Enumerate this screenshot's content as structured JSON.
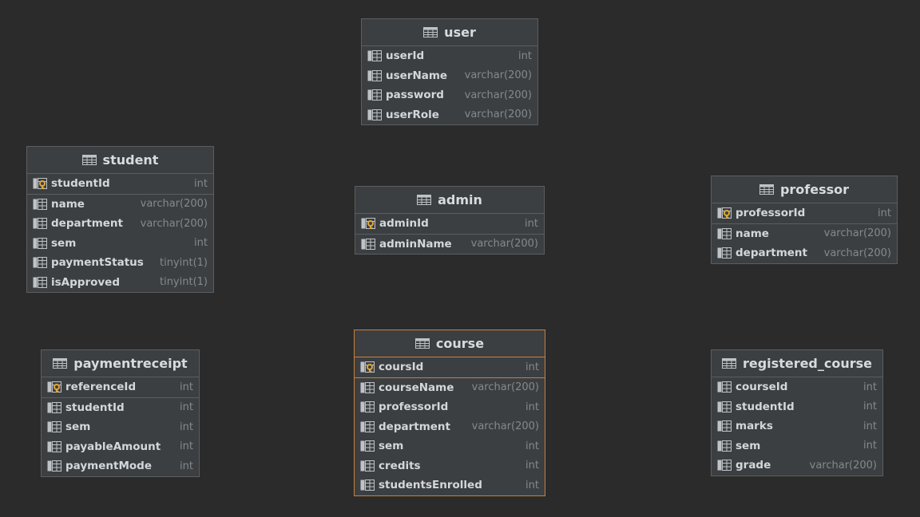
{
  "canvas": {
    "background": "#2b2b2b",
    "border_color": "#5b5e60",
    "selected_border_color": "#c97f3b",
    "key_icon_color": "#e0a83a"
  },
  "tables": {
    "user": {
      "name": "user",
      "columns": [
        {
          "name": "userId",
          "type": "int",
          "icon": "column-icon"
        },
        {
          "name": "userName",
          "type": "varchar(200)",
          "icon": "column-icon"
        },
        {
          "name": "password",
          "type": "varchar(200)",
          "icon": "column-icon"
        },
        {
          "name": "userRole",
          "type": "varchar(200)",
          "icon": "column-icon"
        }
      ]
    },
    "student": {
      "name": "student",
      "primary_key": {
        "name": "studentId",
        "type": "int",
        "icon": "primary-key-icon"
      },
      "columns": [
        {
          "name": "name",
          "type": "varchar(200)",
          "icon": "column-icon"
        },
        {
          "name": "department",
          "type": "varchar(200)",
          "icon": "column-icon"
        },
        {
          "name": "sem",
          "type": "int",
          "icon": "column-icon"
        },
        {
          "name": "paymentStatus",
          "type": "tinyint(1)",
          "icon": "column-icon"
        },
        {
          "name": "isApproved",
          "type": "tinyint(1)",
          "icon": "column-icon"
        }
      ]
    },
    "admin": {
      "name": "admin",
      "primary_key": {
        "name": "adminId",
        "type": "int",
        "icon": "primary-key-icon"
      },
      "columns": [
        {
          "name": "adminName",
          "type": "varchar(200)",
          "icon": "column-icon"
        }
      ]
    },
    "professor": {
      "name": "professor",
      "primary_key": {
        "name": "professorId",
        "type": "int",
        "icon": "primary-key-icon"
      },
      "columns": [
        {
          "name": "name",
          "type": "varchar(200)",
          "icon": "column-icon"
        },
        {
          "name": "department",
          "type": "varchar(200)",
          "icon": "column-icon"
        }
      ]
    },
    "paymentreceipt": {
      "name": "paymentreceipt",
      "primary_key": {
        "name": "referenceId",
        "type": "int",
        "icon": "primary-key-icon"
      },
      "columns": [
        {
          "name": "studentId",
          "type": "int",
          "icon": "column-icon"
        },
        {
          "name": "sem",
          "type": "int",
          "icon": "column-icon"
        },
        {
          "name": "payableAmount",
          "type": "int",
          "icon": "column-icon"
        },
        {
          "name": "paymentMode",
          "type": "int",
          "icon": "column-icon"
        }
      ]
    },
    "course": {
      "name": "course",
      "selected": true,
      "primary_key": {
        "name": "coursId",
        "type": "int",
        "icon": "primary-key-icon"
      },
      "columns": [
        {
          "name": "courseName",
          "type": "varchar(200)",
          "icon": "column-icon"
        },
        {
          "name": "professorId",
          "type": "int",
          "icon": "column-icon"
        },
        {
          "name": "department",
          "type": "varchar(200)",
          "icon": "column-icon"
        },
        {
          "name": "sem",
          "type": "int",
          "icon": "column-icon"
        },
        {
          "name": "credits",
          "type": "int",
          "icon": "column-icon"
        },
        {
          "name": "studentsEnrolled",
          "type": "int",
          "icon": "column-icon"
        }
      ]
    },
    "registered_course": {
      "name": "registered_course",
      "columns": [
        {
          "name": "courseId",
          "type": "int",
          "icon": "column-icon"
        },
        {
          "name": "studentId",
          "type": "int",
          "icon": "column-icon"
        },
        {
          "name": "marks",
          "type": "int",
          "icon": "column-icon"
        },
        {
          "name": "sem",
          "type": "int",
          "icon": "column-icon"
        },
        {
          "name": "grade",
          "type": "varchar(200)",
          "icon": "column-icon"
        }
      ]
    }
  }
}
